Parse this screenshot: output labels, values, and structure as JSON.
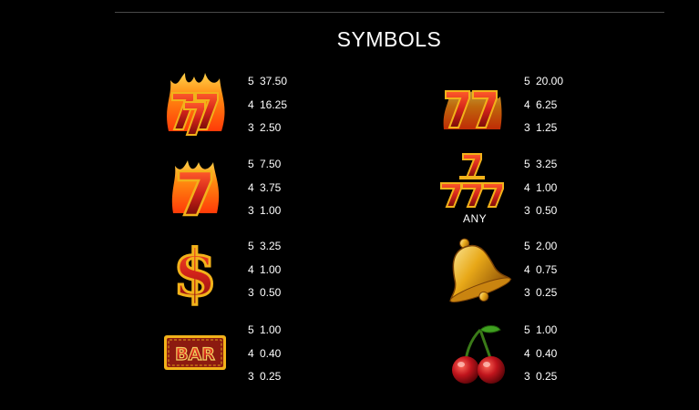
{
  "header": {
    "title": "SYMBOLS"
  },
  "colors": {
    "background": "#000000",
    "text": "#ffffff",
    "seven_red": "#c8201a",
    "gold": "#f2b21a",
    "flame": "#ff7a10",
    "cherry": "#c0141c",
    "bar_plate": "#8c1a10"
  },
  "symbols": [
    {
      "icon": "flaming-triple-seven-icon",
      "caption": "",
      "pays": [
        {
          "count": "5",
          "value": "37.50"
        },
        {
          "count": "4",
          "value": "16.25"
        },
        {
          "count": "3",
          "value": "2.50"
        }
      ]
    },
    {
      "icon": "double-seven-icon",
      "caption": "",
      "pays": [
        {
          "count": "5",
          "value": "20.00"
        },
        {
          "count": "4",
          "value": "6.25"
        },
        {
          "count": "3",
          "value": "1.25"
        }
      ]
    },
    {
      "icon": "flaming-seven-icon",
      "caption": "",
      "pays": [
        {
          "count": "5",
          "value": "7.50"
        },
        {
          "count": "4",
          "value": "3.75"
        },
        {
          "count": "3",
          "value": "1.00"
        }
      ]
    },
    {
      "icon": "any-seven-icon",
      "caption": "ANY",
      "pays": [
        {
          "count": "5",
          "value": "3.25"
        },
        {
          "count": "4",
          "value": "1.00"
        },
        {
          "count": "3",
          "value": "0.50"
        }
      ]
    },
    {
      "icon": "dollar-sign-icon",
      "caption": "",
      "pays": [
        {
          "count": "5",
          "value": "3.25"
        },
        {
          "count": "4",
          "value": "1.00"
        },
        {
          "count": "3",
          "value": "0.50"
        }
      ]
    },
    {
      "icon": "bell-icon",
      "caption": "",
      "pays": [
        {
          "count": "5",
          "value": "2.00"
        },
        {
          "count": "4",
          "value": "0.75"
        },
        {
          "count": "3",
          "value": "0.25"
        }
      ]
    },
    {
      "icon": "bar-icon",
      "caption": "",
      "bar_text": "BAR",
      "pays": [
        {
          "count": "5",
          "value": "1.00"
        },
        {
          "count": "4",
          "value": "0.40"
        },
        {
          "count": "3",
          "value": "0.25"
        }
      ]
    },
    {
      "icon": "cherry-icon",
      "caption": "",
      "pays": [
        {
          "count": "5",
          "value": "1.00"
        },
        {
          "count": "4",
          "value": "0.40"
        },
        {
          "count": "3",
          "value": "0.25"
        }
      ]
    }
  ]
}
